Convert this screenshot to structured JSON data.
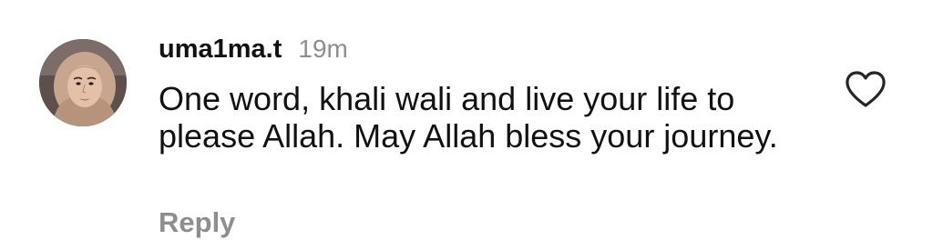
{
  "comment": {
    "username": "uma1ma.t",
    "timestamp": "19m",
    "text": "One word, khali wali and live your life to please Allah. May Allah bless your journey.",
    "reply_label": "Reply",
    "avatar_icon": "profile-photo",
    "like_icon": "heart-outline-icon"
  },
  "colors": {
    "text": "#111111",
    "secondary": "#8e8e8e",
    "background": "#ffffff"
  }
}
